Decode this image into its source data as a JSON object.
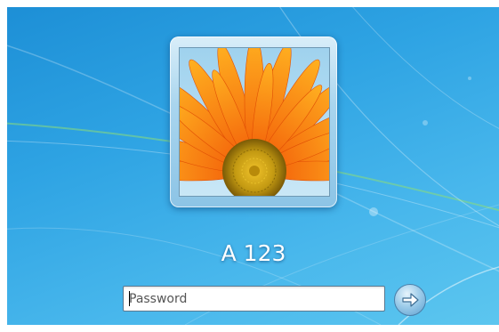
{
  "user": {
    "name": "A 123"
  },
  "login": {
    "password_placeholder": "Password",
    "submit_icon": "arrow-right-icon"
  },
  "colors": {
    "background_blue": "#2ea3e3",
    "tile_frame": "#a9d5ee",
    "flower_orange": "#f26a0d",
    "flower_center": "#c49a12"
  }
}
